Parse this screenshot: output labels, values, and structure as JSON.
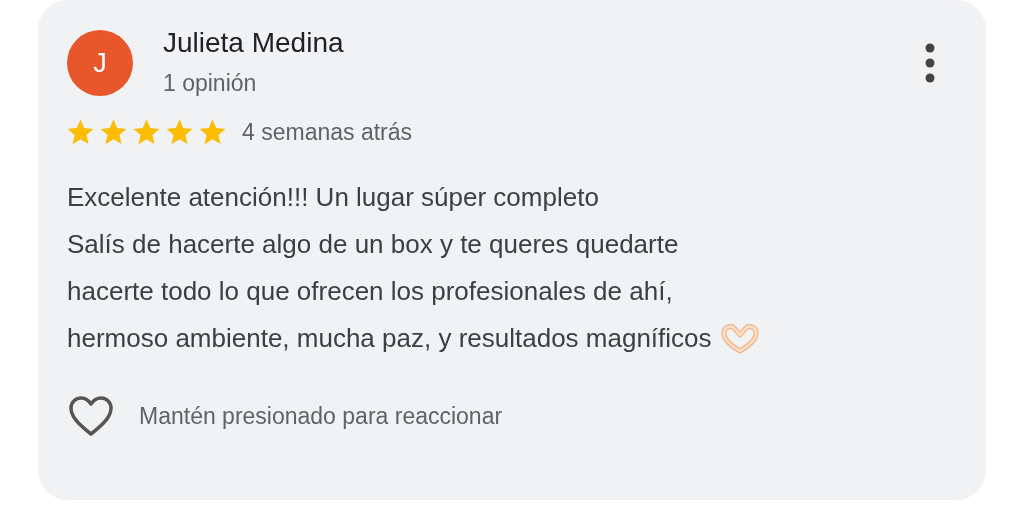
{
  "review": {
    "author": "Julieta Medina",
    "avatar_letter": "J",
    "reviews_count": "1 opinión",
    "stars": 5,
    "time": "4 semanas atrás",
    "lines": [
      "Excelente atención!!! Un lugar súper completo",
      "Salís de hacerte algo de un box y te queres quedarte",
      "hacerte todo lo que ofrecen los profesionales de ahí,",
      "hermoso ambiente, mucha paz, y resultados magníficos"
    ],
    "reaction_hint": "Mantén presionado para reaccionar"
  }
}
